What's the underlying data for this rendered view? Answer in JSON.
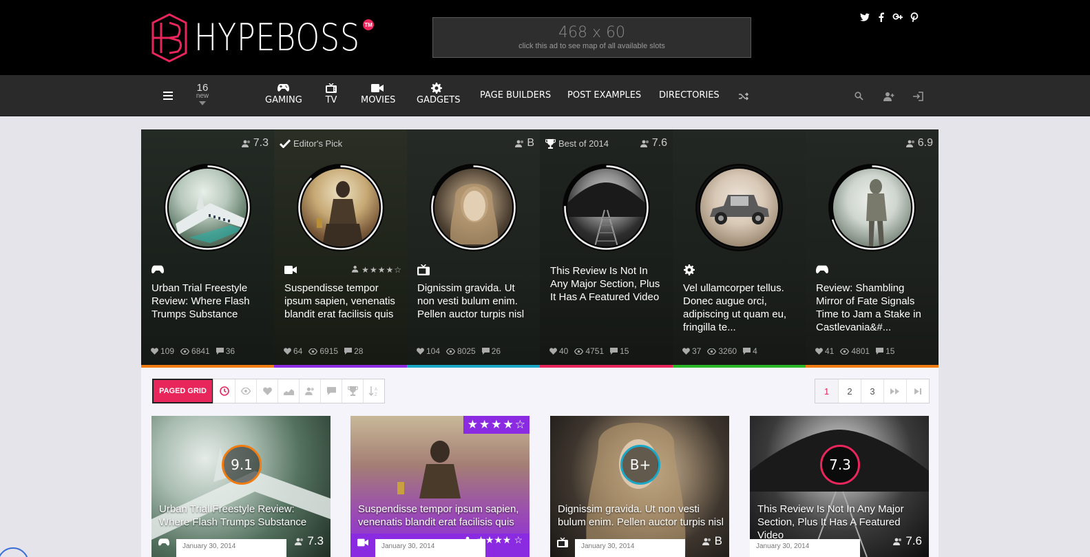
{
  "brand": {
    "name": "HYPEBOSS",
    "tm": "TM"
  },
  "ad": {
    "size": "468 x 60",
    "caption": "click this ad to see map of all available slots"
  },
  "social": [
    "twitter-icon",
    "facebook-icon",
    "google-plus-icon",
    "pinterest-icon"
  ],
  "nav": {
    "new_count": "16",
    "new_label": "new",
    "items": [
      {
        "label": "GAMING",
        "icon": "gamepad-icon"
      },
      {
        "label": "TV",
        "icon": "tv-icon"
      },
      {
        "label": "MOVIES",
        "icon": "video-camera-icon"
      },
      {
        "label": "GADGETS",
        "icon": "gear-icon"
      }
    ],
    "plain": [
      "PAGE BUILDERS",
      "POST EXAMPLES",
      "DIRECTORIES"
    ]
  },
  "featured": [
    {
      "badge": "",
      "score": "7.3",
      "category": "gamepad-icon",
      "title": "Urban Trial Freestyle Review: Where Flash Trumps Substance",
      "likes": "109",
      "views": "6841",
      "comments": "36",
      "stripe": "#f07c12"
    },
    {
      "badge": "Editor's Pick",
      "score": "",
      "stars": 4,
      "category": "video-camera-icon",
      "title": "Suspendisse tempor ipsum sapien, venenatis blandit erat facilisis quis",
      "likes": "64",
      "views": "6915",
      "comments": "28",
      "stripe": "#8b2be2"
    },
    {
      "badge": "",
      "score": "B",
      "category": "tv-icon",
      "title": "Dignissim gravida. Ut non vesti bulum enim. Pellen auctor turpis nisl",
      "likes": "104",
      "views": "8025",
      "comments": "26",
      "stripe": "#1aa8c8"
    },
    {
      "badge": "Best of 2014",
      "score": "7.6",
      "category": "",
      "title": "This Review Is Not In Any Major Section, Plus It Has A Featured Video",
      "likes": "40",
      "views": "4751",
      "comments": "15",
      "stripe": "#e8265c"
    },
    {
      "badge": "",
      "score": "",
      "category": "gear-icon",
      "title": "Vel ullamcorper tellus. Donec augue orci, adipiscing ut quam eu, fringilla te...",
      "likes": "37",
      "views": "3260",
      "comments": "4",
      "stripe": "#28b828"
    },
    {
      "badge": "",
      "score": "6.9",
      "category": "gamepad-icon",
      "title": "Review: Shambling Mirror of Fate Signals Time to Jam a Stake in Castlevania&#...",
      "likes": "41",
      "views": "4801",
      "comments": "15",
      "stripe": "#f07c12"
    }
  ],
  "toolbar": {
    "paged_label": "PAGED GRID",
    "sort_icons": [
      "clock-icon",
      "eye-icon",
      "heart-icon",
      "chart-icon",
      "users-icon",
      "comment-icon",
      "trophy-icon",
      "sort-alpha-icon"
    ],
    "pages": [
      "1",
      "2",
      "3"
    ]
  },
  "grid": [
    {
      "score": "9.1",
      "ring": "#f07c12",
      "title": "Urban Trial Freestyle Review: Where Flash Trumps Substance",
      "date": "January 30, 2014",
      "foot_score": "7.3",
      "category": "gamepad-icon"
    },
    {
      "score": "",
      "stars": 4.5,
      "title": "Suspendisse tempor ipsum sapien, venenatis blandit erat facilisis quis",
      "date": "January 30, 2014",
      "foot_score": "",
      "category": "video-camera-icon"
    },
    {
      "score": "B+",
      "ring": "#1aa8c8",
      "title": "Dignissim gravida. Ut non vesti bulum enim. Pellen auctor turpis nisl",
      "date": "January 30, 2014",
      "foot_score": "B",
      "category": "tv-icon"
    },
    {
      "score": "7.3",
      "ring": "#e8265c",
      "title": "This Review Is Not In Any Major Section, Plus It Has A Featured Video",
      "date": "January 30, 2014",
      "foot_score": "7.6",
      "category": ""
    }
  ],
  "colors": {
    "accent": "#e8265c",
    "nav_bg": "#2a2a2a",
    "top_bg": "#000000"
  }
}
